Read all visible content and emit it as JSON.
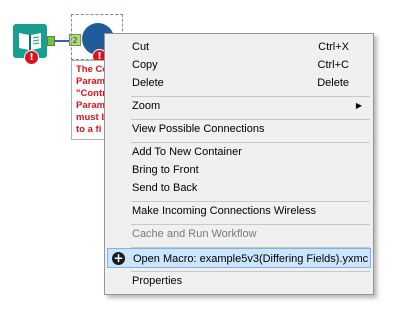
{
  "canvas": {
    "input_tool_icon": "book-icon",
    "error_icon_text": "!",
    "connection_anchor_label": "2",
    "error_note_lines": [
      "The Co",
      "Param",
      "\"Contr",
      "Param",
      "must b",
      "to a fi"
    ]
  },
  "context_menu": {
    "cut": {
      "label": "Cut",
      "shortcut": "Ctrl+X"
    },
    "copy": {
      "label": "Copy",
      "shortcut": "Ctrl+C"
    },
    "delete": {
      "label": "Delete",
      "shortcut": "Delete"
    },
    "zoom": {
      "label": "Zoom",
      "submenu_icon": "triangle-right-icon"
    },
    "view_possible_connections": {
      "label": "View Possible Connections"
    },
    "add_to_new_container": {
      "label": "Add To New Container"
    },
    "bring_to_front": {
      "label": "Bring to Front"
    },
    "send_to_back": {
      "label": "Send to Back"
    },
    "make_incoming_wireless": {
      "label": "Make Incoming Connections Wireless"
    },
    "cache_and_run": {
      "label": "Cache and Run Workflow",
      "disabled": true
    },
    "open_macro": {
      "label": "Open Macro: example5v3(Differing Fields).yxmc",
      "icon": "plus-circle-icon",
      "highlighted": true
    },
    "properties": {
      "label": "Properties"
    }
  },
  "colors": {
    "menu_background": "#f0f0f0",
    "highlight_background": "#cce5fb",
    "highlight_border": "#7eb4ea",
    "error_red": "#e0121c",
    "macro_blue": "#1f5c99",
    "input_tool_teal": "#1a9e8f"
  }
}
